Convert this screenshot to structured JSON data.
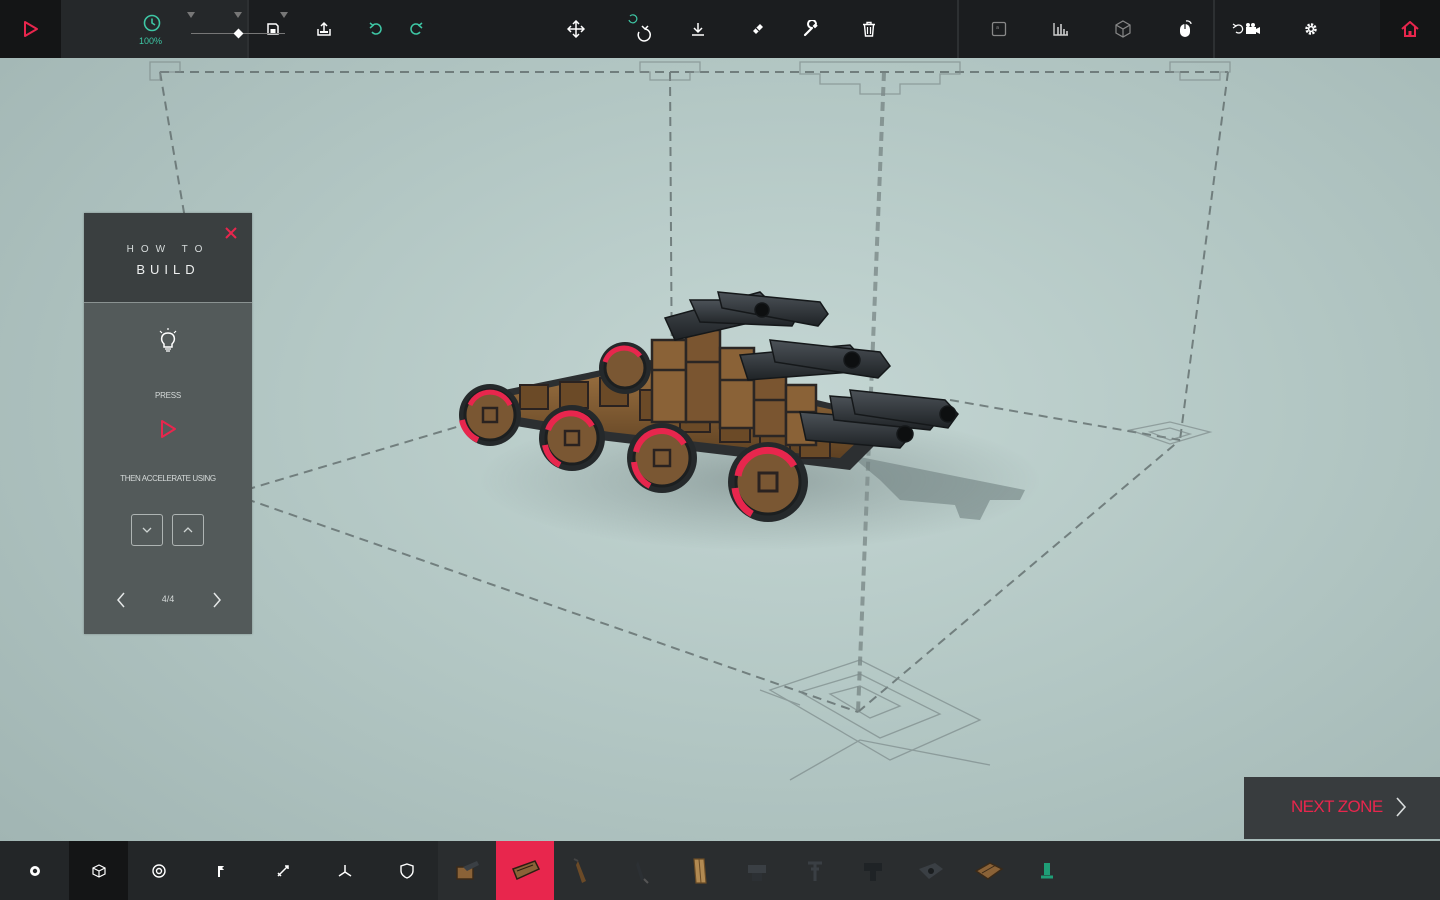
{
  "toolbar": {
    "time_scale": "100%",
    "colors": {
      "accent": "#e8264d",
      "time_green": "#3ec7a5",
      "bar_bg": "#1b1d1f"
    },
    "left_tools": [
      "save-icon",
      "load-icon",
      "undo-icon",
      "redo-icon"
    ],
    "center_tools": [
      "translate-icon",
      "rotate-icon",
      "snap-to-ground-icon",
      "eraser-icon",
      "wrench-icon",
      "trash-icon"
    ],
    "right_tools": [
      "key-mapper-icon",
      "stats-icon",
      "box-view-icon",
      "mouse-orbit-icon",
      "camera-icon",
      "settings-icon",
      "home-icon"
    ]
  },
  "how_to_build": {
    "title_small": "HOW TO",
    "title_large": "BUILD",
    "press_label": "PRESS",
    "accelerate_label": "THEN ACCELERATE USING",
    "page": "4/4"
  },
  "next_zone": {
    "label": "NEXT ZONE"
  },
  "bottom_categories": [
    "settings-cog-icon",
    "blocks-cube-icon",
    "wheel-target-icon",
    "mechanical-icon",
    "weapons-icon",
    "flight-icon",
    "armour-icon"
  ],
  "bottom_blocks": [
    "cannon-block",
    "holder-block",
    "spike-block",
    "drill-block",
    "wooden-panel-block",
    "anvil-block",
    "crossbow-block",
    "flamethrower-block",
    "vacuum-block",
    "crate-block",
    "ballast-block"
  ]
}
